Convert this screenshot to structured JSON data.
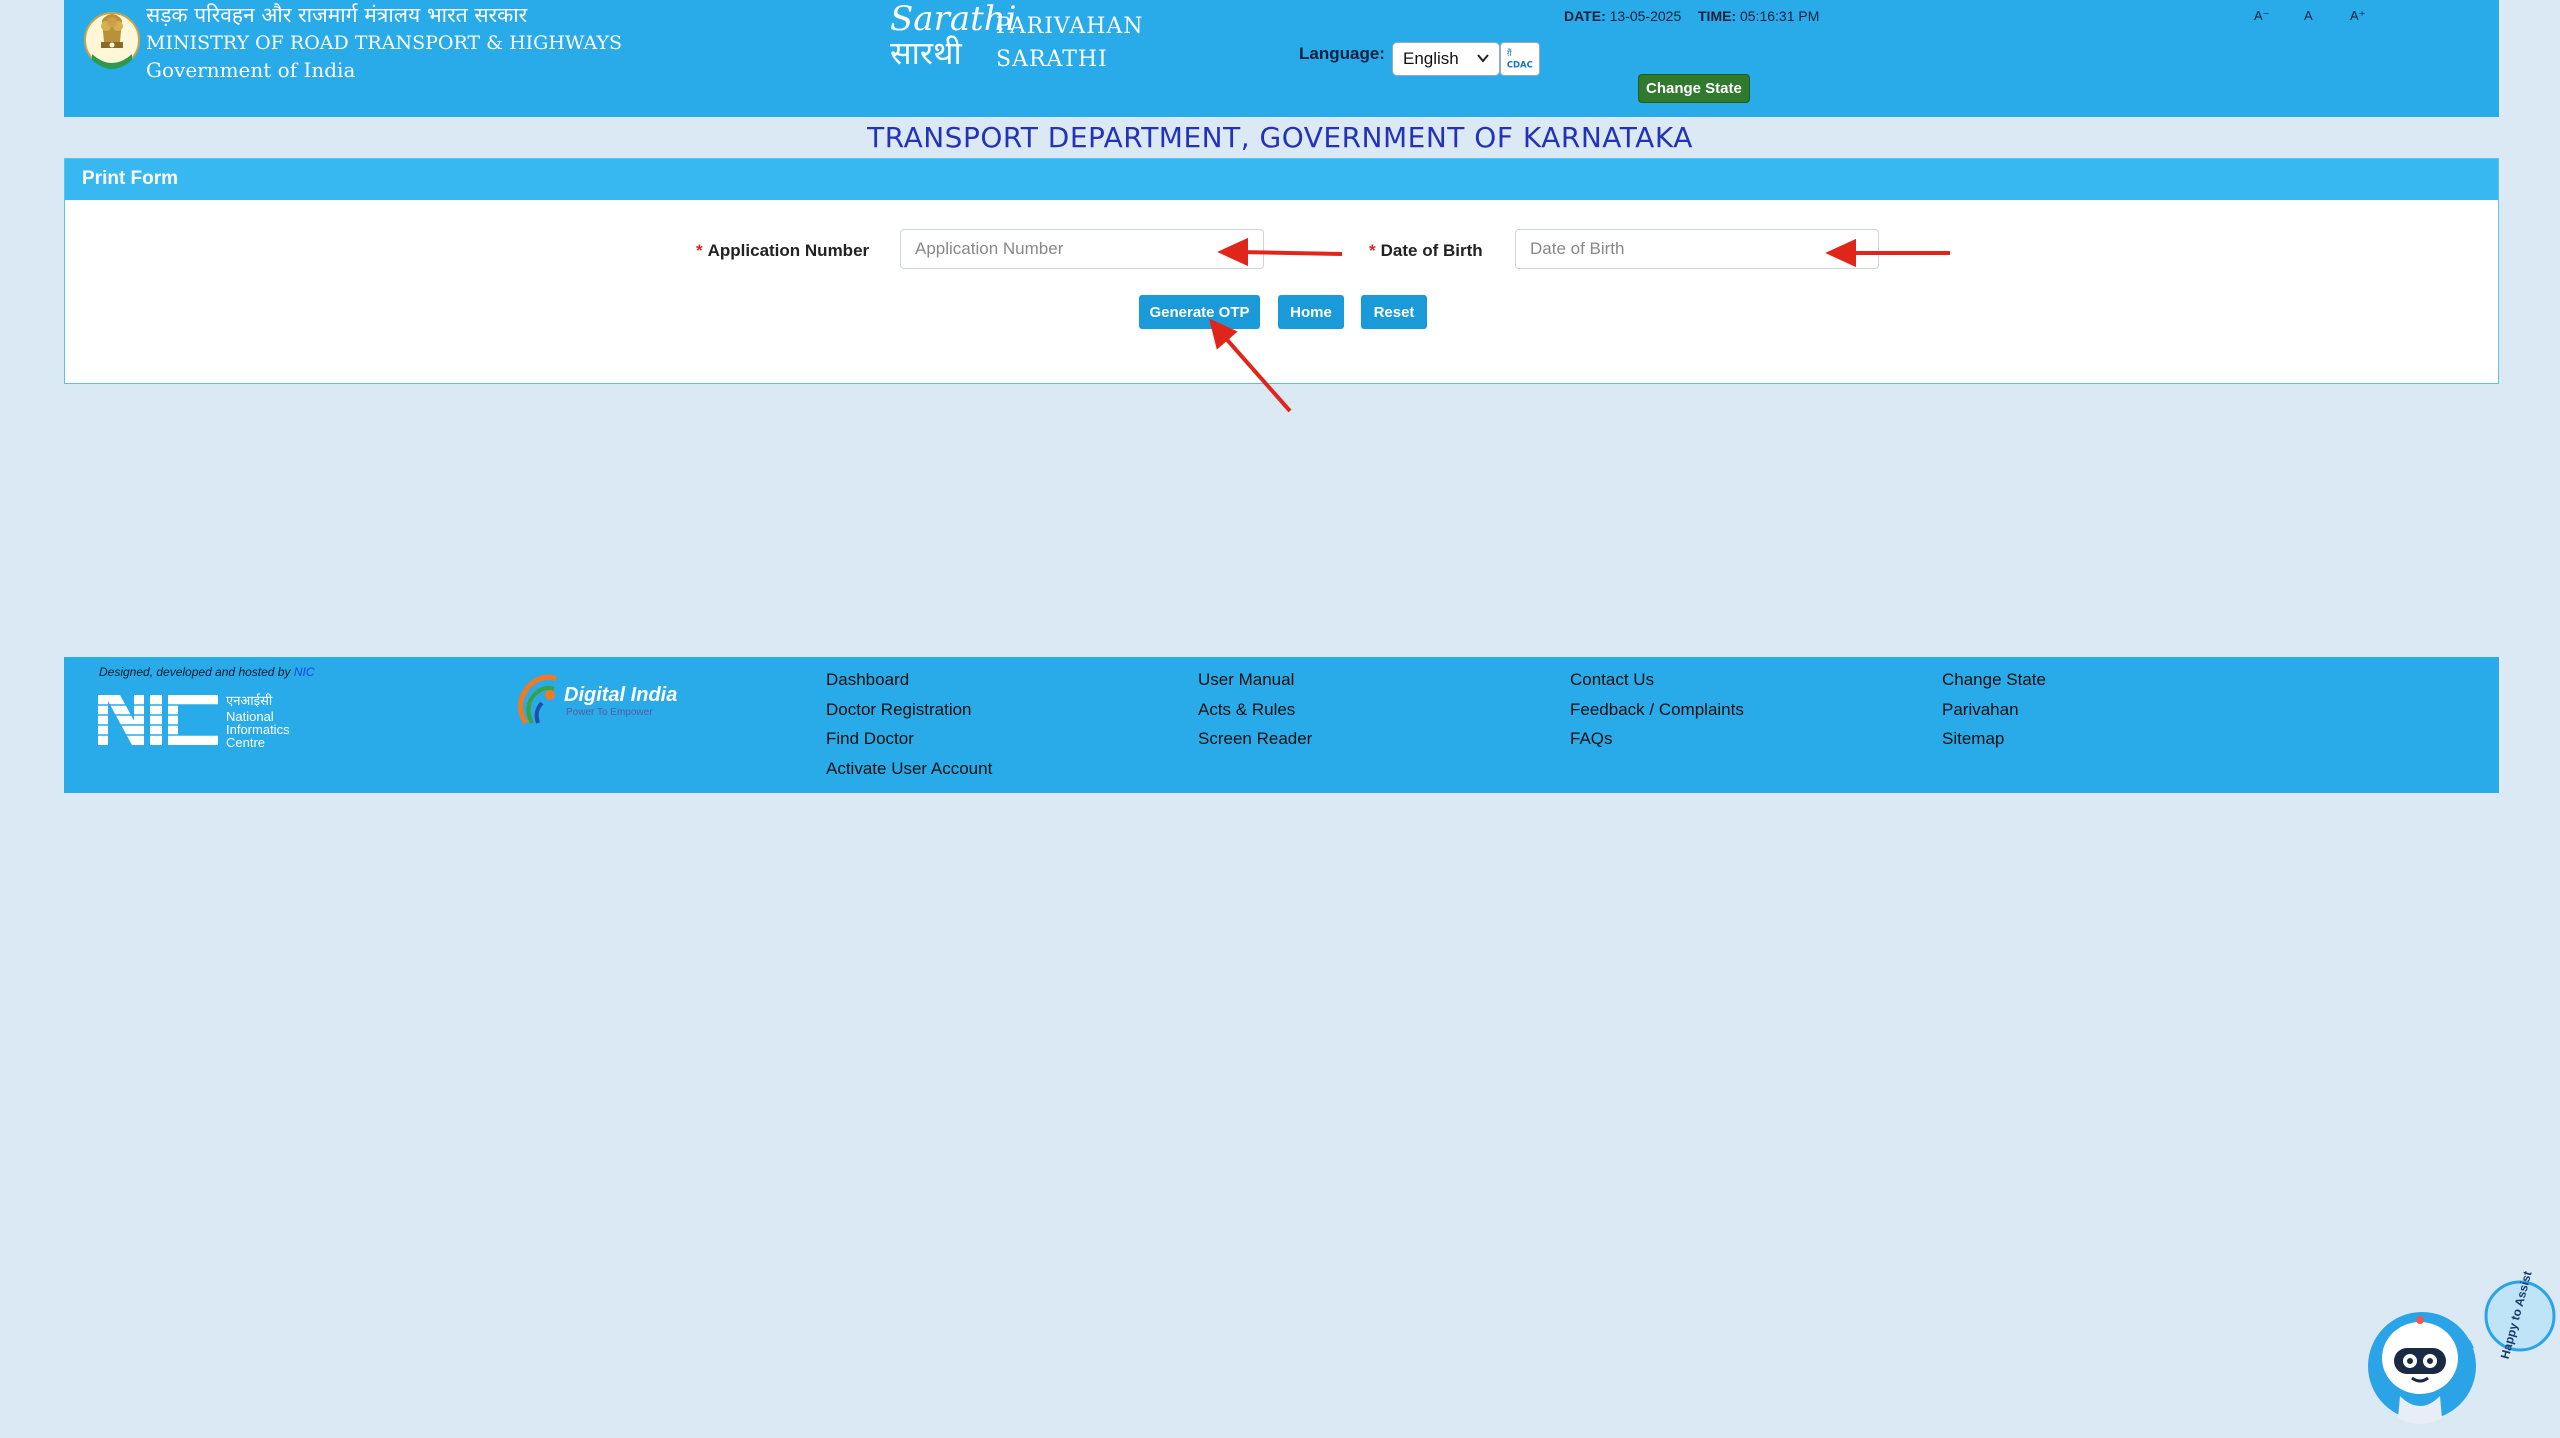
{
  "header": {
    "ministry_hindi": "सड़क परिवहन और राजमार्ग मंत्रालय भारत सरकार",
    "ministry_english": "MINISTRY OF ROAD TRANSPORT & HIGHWAYS",
    "government": "Government of India",
    "parivahan": "PARIVAHAN",
    "sarathi": "SARATHI",
    "language_label": "Language:",
    "language_selected": "English",
    "date_label": "DATE:",
    "date_value": "13-05-2025",
    "time_label": "TIME:",
    "time_value": "05:16:31 PM",
    "change_state": "Change State",
    "font_decrease": "A⁻",
    "font_normal": "A",
    "font_increase": "A⁺"
  },
  "department_title": "TRANSPORT DEPARTMENT, GOVERNMENT OF KARNATAKA",
  "form": {
    "panel_title": "Print Form",
    "required_mark": "*",
    "application_number_label": "Application Number",
    "application_number_placeholder": "Application Number",
    "dob_label": "Date of Birth",
    "dob_placeholder": "Date of Birth",
    "generate_otp": "Generate OTP",
    "home": "Home",
    "reset": "Reset"
  },
  "footer": {
    "credit_text": "Designed, developed and hosted by",
    "credit_link": "NIC",
    "nic_hindi": "एनआईसी",
    "nic_name": [
      "National",
      "Informatics",
      "Centre"
    ],
    "digital_india": "Digital India",
    "digital_india_tagline": "Power To Empower",
    "col1": [
      "Dashboard",
      "Doctor Registration",
      "Find Doctor",
      "Activate User Account"
    ],
    "col2": [
      "User Manual",
      "Acts & Rules",
      "Screen Reader"
    ],
    "col3": [
      "Contact Us",
      "Feedback / Complaints",
      "FAQs"
    ],
    "col4": [
      "Change State",
      "Parivahan",
      "Sitemap"
    ]
  },
  "chatbot": {
    "bubble_text": "Happy to Assist"
  },
  "colors": {
    "header_bg": "#29abe9",
    "page_bg": "#dbe9f5",
    "title_blue": "#2432b8",
    "button_blue": "#1a9ad9",
    "change_state_green": "#2f7a2c",
    "annotation_red": "#e0261b"
  }
}
